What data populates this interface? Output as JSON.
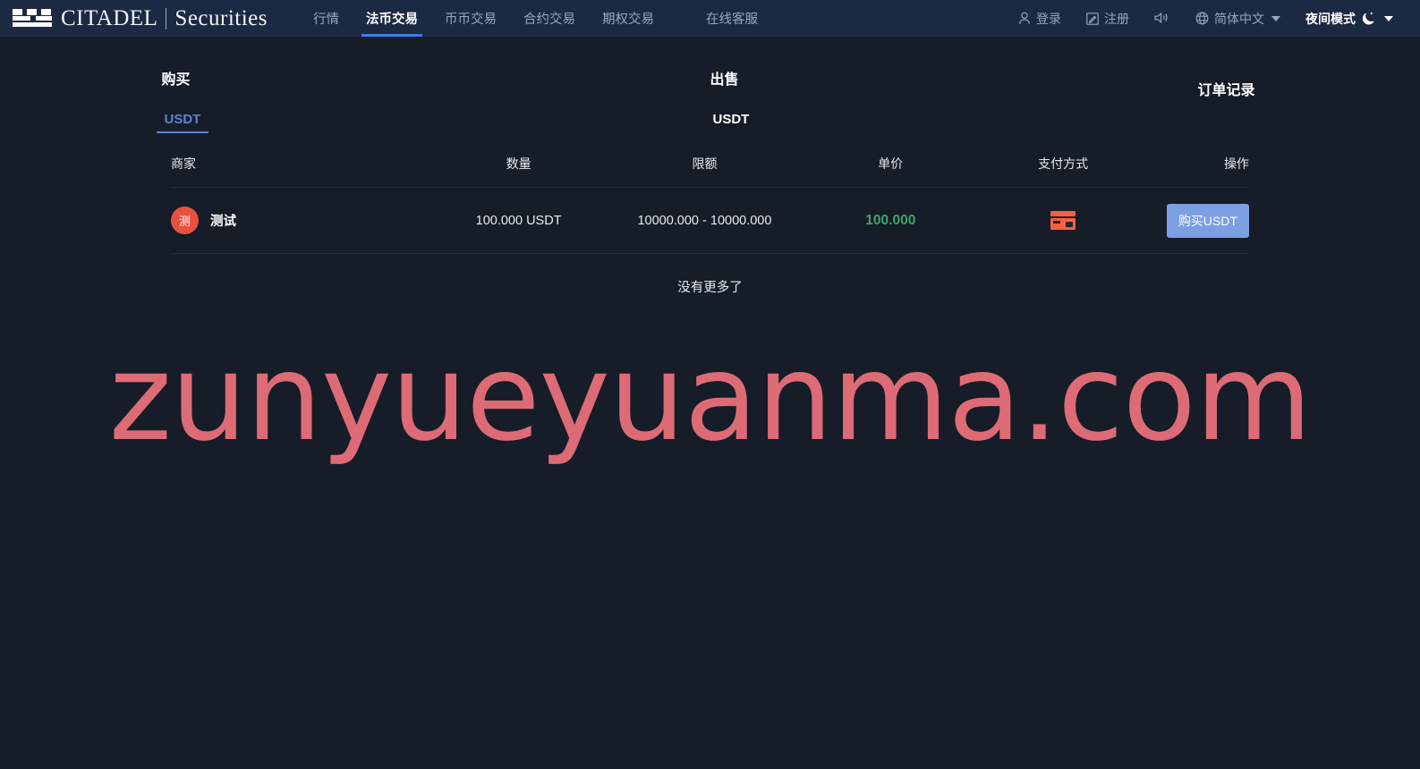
{
  "brand": {
    "logo_icon": "citadel-battlement-logo",
    "name": "CITADEL",
    "divider": "|",
    "suffix": "Securities"
  },
  "nav": {
    "items": [
      {
        "label": "行情",
        "active": false
      },
      {
        "label": "法币交易",
        "active": true
      },
      {
        "label": "币币交易",
        "active": false
      },
      {
        "label": "合约交易",
        "active": false
      },
      {
        "label": "期权交易",
        "active": false
      },
      {
        "label": "在线客服",
        "active": false
      }
    ]
  },
  "header_right": {
    "login": "登录",
    "register": "注册",
    "language": "简体中文",
    "night_mode": "夜间模式",
    "icons": {
      "user": "user-icon",
      "edit": "edit-icon",
      "sound": "speaker-icon",
      "globe": "globe-icon",
      "moon": "moon-icon"
    }
  },
  "panels": {
    "buy": {
      "title": "购买",
      "tabs": [
        {
          "label": "USDT",
          "active": true
        }
      ]
    },
    "sell": {
      "title": "出售",
      "tabs": [
        {
          "label": "USDT",
          "active": false
        }
      ]
    },
    "orders": {
      "title": "订单记录"
    }
  },
  "table": {
    "columns": {
      "merchant": "商家",
      "amount": "数量",
      "limit": "限额",
      "price": "单价",
      "payment": "支付方式",
      "action": "操作"
    },
    "rows": [
      {
        "avatar_text": "测",
        "avatar_color": "#e8513f",
        "merchant": "测试",
        "amount": "100.000 USDT",
        "limit": "10000.000 - 10000.000",
        "price": "100.000",
        "price_color": "#3fa46a",
        "payment_icon": "bank-card-icon",
        "action_label": "购买USDT",
        "action_color": "#7b9fe0"
      }
    ],
    "footer_text": "没有更多了"
  },
  "watermark": {
    "text": "zunyueyuanma.com",
    "color": "#dd6b76"
  },
  "theme": {
    "header_bg": "#1c2943",
    "page_bg": "#161c28",
    "accent_blue": "#3d7de8",
    "tab_blue": "#5b84d8",
    "muted_text": "#96a6c4",
    "divider": "#222b3c"
  }
}
